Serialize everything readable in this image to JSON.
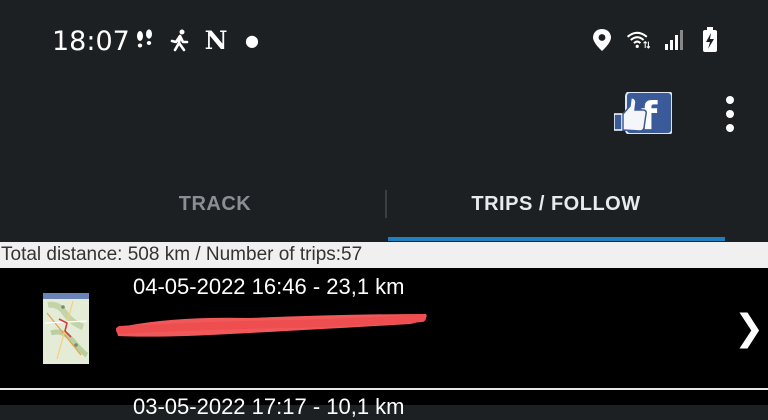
{
  "status_bar": {
    "time": "18:07",
    "left_icons": [
      "footprints-icon",
      "walking-person-icon",
      "netflix-icon",
      "dot-icon"
    ],
    "right_icons": [
      "location-icon",
      "wifi-icon",
      "signal-icon",
      "battery-charging-icon"
    ]
  },
  "app_bar": {
    "actions": [
      "facebook-like-icon",
      "overflow-menu-icon"
    ]
  },
  "tabs": [
    {
      "label": "TRACK",
      "selected": false
    },
    {
      "label": "TRIPS / FOLLOW",
      "selected": true
    }
  ],
  "summary": {
    "text": "Total distance: 508 km / Number of trips:57"
  },
  "trips": [
    {
      "title": "04-05-2022 16:46 - 23,1 km",
      "subtitle_redacted": true,
      "icon": "map-thumbnail",
      "action_icon": "chevron-right-icon",
      "chevron": "❯"
    },
    {
      "title": "03-05-2022 17:17 - 10,1 km"
    }
  ],
  "colors": {
    "background": "#1d2023",
    "accent": "#1f7fbf",
    "list_background": "#000000",
    "redaction": "#f0585a"
  }
}
